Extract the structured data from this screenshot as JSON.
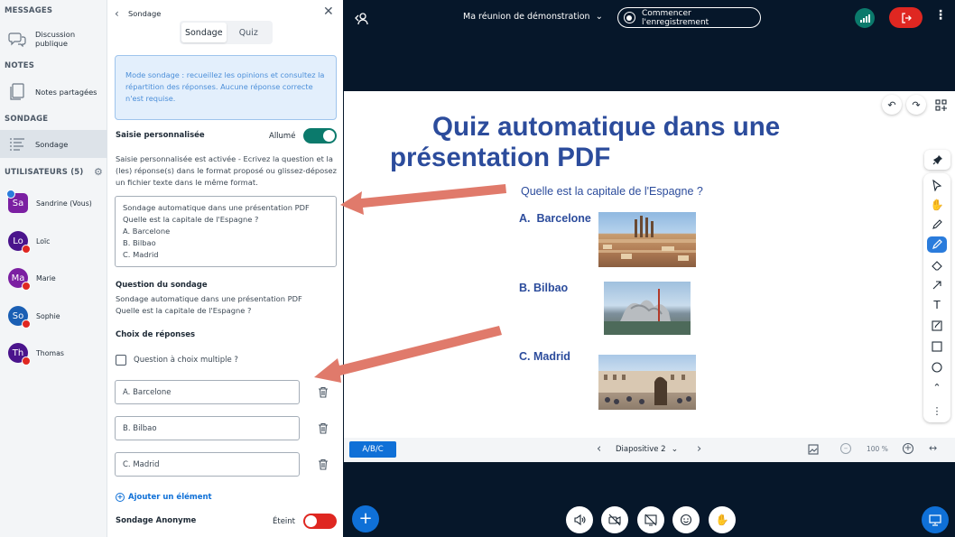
{
  "sidebar": {
    "messages_heading": "MESSAGES",
    "public_chat": "Discussion publique",
    "notes_heading": "NOTES",
    "shared_notes": "Notes partagées",
    "poll_heading": "SONDAGE",
    "poll_item": "Sondage",
    "users_heading": "UTILISATEURS (5)",
    "users": [
      {
        "initials": "Sa",
        "name": "Sandrine (Vous)",
        "color": "#7b1fa2"
      },
      {
        "initials": "Lo",
        "name": "Loïc",
        "color": "#4a148c"
      },
      {
        "initials": "Ma",
        "name": "Marie",
        "color": "#7b1fa2"
      },
      {
        "initials": "So",
        "name": "Sophie",
        "color": "#1a5fb4"
      },
      {
        "initials": "Th",
        "name": "Thomas",
        "color": "#4a148c"
      }
    ]
  },
  "panel": {
    "title": "Sondage",
    "tab_poll": "Sondage",
    "tab_quiz": "Quiz",
    "info": "Mode sondage : recueillez les opinions et consultez la répartition des réponses. Aucune réponse correcte n'est requise.",
    "custom_input_label": "Saisie personnalisée",
    "custom_input_state": "Allumé",
    "custom_input_help": "Saisie personnalisée est activée - Ecrivez la question et la (les) réponse(s) dans le format proposé ou glissez-déposez un fichier texte dans le même format.",
    "textarea_lines": [
      "Sondage automatique dans une présentation PDF",
      "Quelle est la capitale de l'Espagne ?",
      "A. Barcelone",
      "B. Bilbao",
      "C. Madrid"
    ],
    "question_label": "Question du sondage",
    "question_lines": [
      "Sondage automatique dans une présentation PDF",
      "Quelle est la capitale de l'Espagne ?"
    ],
    "choices_label": "Choix de réponses",
    "multiple_choice": "Question à choix multiple ?",
    "options": [
      "A. Barcelone",
      "B. Bilbao",
      "C. Madrid"
    ],
    "add_item": "Ajouter un élément",
    "anonymous_label": "Sondage Anonyme",
    "anonymous_state": "Éteint"
  },
  "topbar": {
    "meeting_title": "Ma réunion de démonstration",
    "record_label": "Commencer l'enregistrement"
  },
  "slide": {
    "title_line1": "Quiz automatique dans une",
    "title_line2": "présentation PDF",
    "question": "Quelle est la capitale de l'Espagne ?",
    "answers": [
      "A.  Barcelone",
      "B. Bilbao",
      "C. Madrid"
    ]
  },
  "slidebar": {
    "quick_poll": "A/B/C",
    "slide_label": "Diapositive 2",
    "zoom": "100 %"
  },
  "colors": {
    "accent": "#0f70d7",
    "toggle_on": "#0b7a6c",
    "toggle_off": "#df2721",
    "slide_title": "#2c4c9c",
    "arrow": "#e07a6b"
  }
}
